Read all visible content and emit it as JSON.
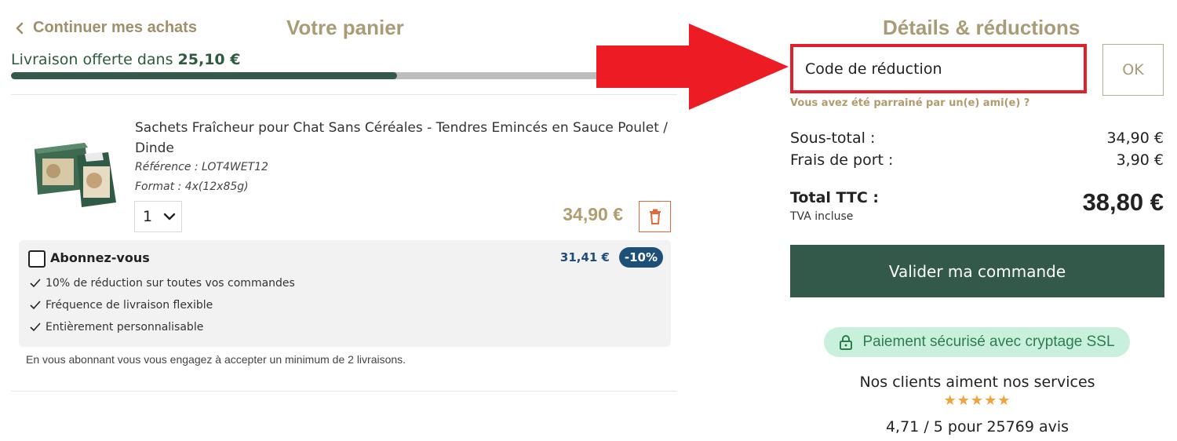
{
  "header": {
    "back_label": "Continuer mes achats",
    "cart_title": "Votre panier",
    "details_title": "Détails & réductions"
  },
  "shipping": {
    "prefix": "Livraison offerte dans",
    "remaining": "25,10 €",
    "progress_fraction": 0.58
  },
  "product": {
    "name": "Sachets Fraîcheur pour Chat Sans Céréales - Tendres Emincés en Sauce Poulet / Dinde",
    "reference": "Référence : LOT4WET12",
    "format": "Format : 4x(12x85g)",
    "quantity": "1",
    "price": "34,90 €"
  },
  "subscription": {
    "title": "Abonnez-vous",
    "price": "31,41 €",
    "badge": "-10%",
    "features": [
      "10% de réduction sur toutes vos commandes",
      "Fréquence de livraison flexible",
      "Entièrement personnalisable"
    ],
    "note": "En vous abonnant vous vous engagez à accepter un minimum de 2 livraisons."
  },
  "promo": {
    "placeholder": "Code de réduction",
    "ok_label": "OK",
    "referral_link": "Vous avez été parrainé par un(e) ami(e) ?"
  },
  "summary": {
    "subtotal_label": "Sous-total :",
    "subtotal_value": "34,90 €",
    "shipping_label": "Frais de port :",
    "shipping_value": "3,90 €",
    "total_label": "Total TTC :",
    "vat_note": "TVA incluse",
    "total_value": "38,80 €"
  },
  "checkout": {
    "validate_label": "Valider ma commande",
    "ssl_label": "Paiement sécurisé avec cryptage SSL"
  },
  "reviews": {
    "text": "Nos clients aiment nos services",
    "stars": "★★★★★",
    "rating": "4,71 / 5 pour 25769 avis"
  },
  "colors": {
    "brand_green": "#33594a",
    "gold": "#a99b76",
    "highlight_red": "#e0202a",
    "subscribe_blue": "#1e4f78",
    "ssl_bg": "#c9f0dc",
    "star": "#f0a33a"
  },
  "icons": {
    "back": "chevron-left-icon",
    "quantity": "chevron-down-icon",
    "delete": "trash-icon",
    "feature": "check-icon",
    "ssl": "lock-icon",
    "annotation": "red-arrow-icon"
  }
}
